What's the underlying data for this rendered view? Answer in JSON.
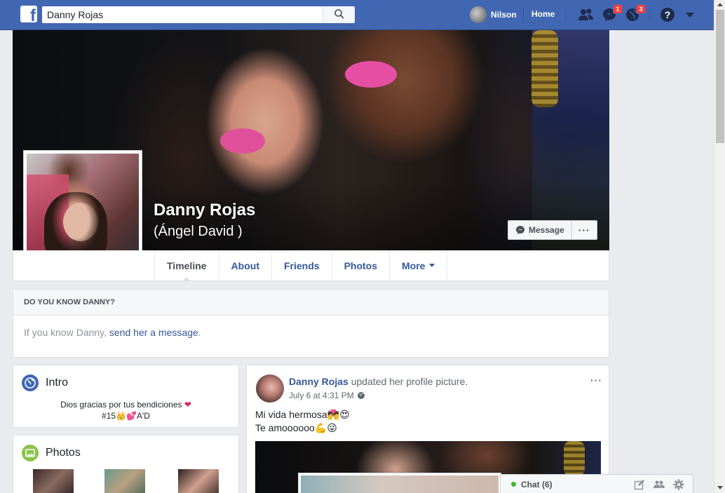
{
  "topbar": {
    "search_value": "Danny Rojas",
    "user_name": "Nilson",
    "home_label": "Home",
    "messages_badge": "1",
    "notifications_badge": "3",
    "brand_color": "#4267b2"
  },
  "profile": {
    "name": "Danny Rojas",
    "alternate_name": "(Ángel David )",
    "message_label": "Message",
    "more_label": "···"
  },
  "tabs": [
    {
      "label": "Timeline",
      "active": true
    },
    {
      "label": "About"
    },
    {
      "label": "Friends"
    },
    {
      "label": "Photos"
    },
    {
      "label": "More"
    }
  ],
  "know_box": {
    "title": "DO YOU KNOW DANNY?",
    "text_prefix": "If you know Danny, ",
    "link_text": "send her a message",
    "text_suffix": "."
  },
  "intro": {
    "title": "Intro",
    "bio_line1": "Dios gracias por tus bendiciones",
    "bio_line1_emoji": "❤",
    "bio_line2_start": "#15",
    "bio_line2_emoji1": "👑",
    "bio_line2_emoji2": "💕",
    "bio_line2_end": "A'D"
  },
  "photos": {
    "title": "Photos"
  },
  "post": {
    "author": "Danny Rojas",
    "action": "updated her profile picture.",
    "timestamp": "July 6 at 4:31 PM",
    "dots": "···",
    "line1": "Mi vida hermosa",
    "line1_emoji1": "💏",
    "line1_emoji2": "😍",
    "line2": "Te amoooooo",
    "line2_emoji1": "💪",
    "line2_emoji2": "😜"
  },
  "chat": {
    "label": "Chat (6)"
  }
}
